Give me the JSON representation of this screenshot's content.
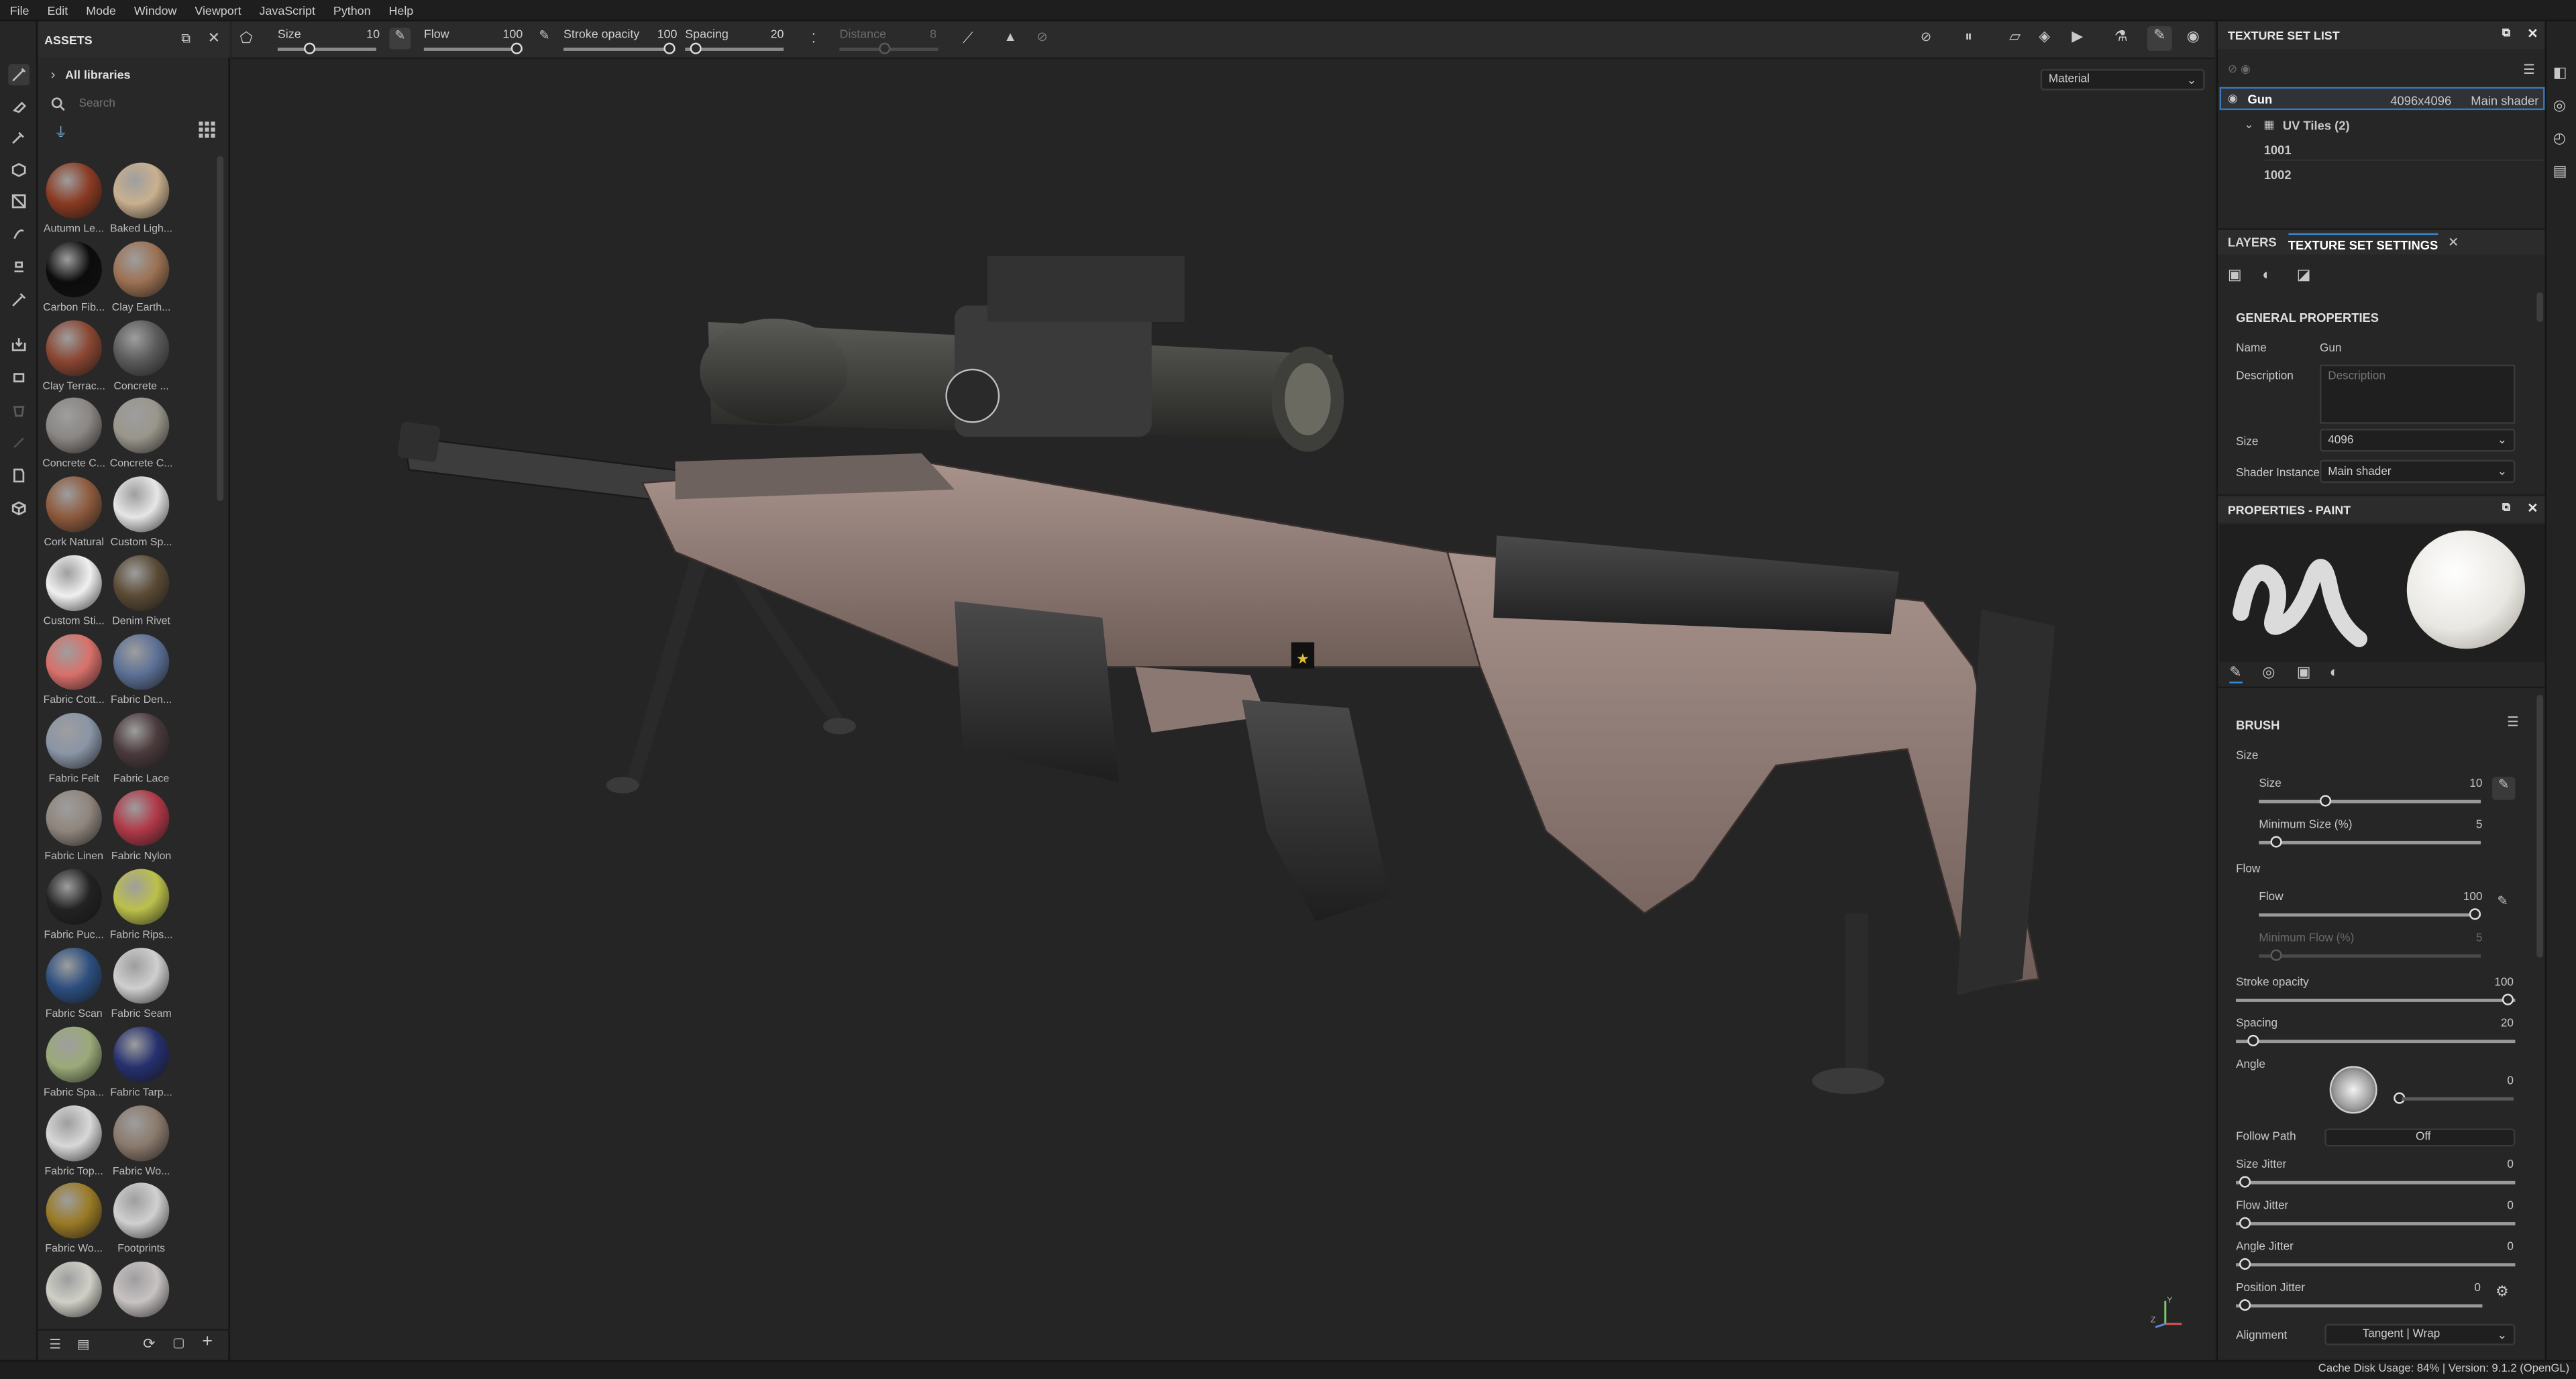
{
  "menu": [
    "File",
    "Edit",
    "Mode",
    "Window",
    "Viewport",
    "JavaScript",
    "Python",
    "Help"
  ],
  "assets": {
    "title": "ASSETS",
    "library": "All libraries",
    "search_placeholder": "Search",
    "items": [
      {
        "label": "Autumn Le...",
        "color": "#8a3a22"
      },
      {
        "label": "Baked Ligh...",
        "color": "#c9b08f"
      },
      {
        "label": "Carbon Fib...",
        "color": "#0c0c0c"
      },
      {
        "label": "Clay Earth...",
        "color": "#9c7153"
      },
      {
        "label": "Clay Terrac...",
        "color": "#8a4531"
      },
      {
        "label": "Concrete ...",
        "color": "#5a5a5a"
      },
      {
        "label": "Concrete C...",
        "color": "#8a8683"
      },
      {
        "label": "Concrete C...",
        "color": "#9a968c"
      },
      {
        "label": "Cork Natural",
        "color": "#8e5a3d"
      },
      {
        "label": "Custom Sp...",
        "color": "#e6e6e6"
      },
      {
        "label": "Custom Sti...",
        "color": "#f0f0f0"
      },
      {
        "label": "Denim Rivet",
        "color": "#5a4a35"
      },
      {
        "label": "Fabric Cott...",
        "color": "#d9706a"
      },
      {
        "label": "Fabric Den...",
        "color": "#5c7096"
      },
      {
        "label": "Fabric Felt",
        "color": "#8a95a6"
      },
      {
        "label": "Fabric Lace",
        "color": "#4a3a3c"
      },
      {
        "label": "Fabric Linen",
        "color": "#8f857c"
      },
      {
        "label": "Fabric Nylon",
        "color": "#b03848"
      },
      {
        "label": "Fabric Puc...",
        "color": "#222222"
      },
      {
        "label": "Fabric Rips...",
        "color": "#bcc04a"
      },
      {
        "label": "Fabric Scan",
        "color": "#2c4e7e"
      },
      {
        "label": "Fabric Seam",
        "color": "#cfcfcf"
      },
      {
        "label": "Fabric Spa...",
        "color": "#9aaa78"
      },
      {
        "label": "Fabric Tarp...",
        "color": "#26306e"
      },
      {
        "label": "Fabric Top...",
        "color": "#d8d8d8"
      },
      {
        "label": "Fabric Wo...",
        "color": "#8a7a6c"
      },
      {
        "label": "Fabric Wo...",
        "color": "#9a7a25"
      },
      {
        "label": "Footprints",
        "color": "#d0d0d0"
      },
      {
        "label": "",
        "color": "#cfcfc6"
      },
      {
        "label": "",
        "color": "#c8c2c2"
      }
    ]
  },
  "toolbar": {
    "size_label": "Size",
    "size_value": "10",
    "flow_label": "Flow",
    "flow_value": "100",
    "stroke_label": "Stroke opacity",
    "stroke_value": "100",
    "spacing_label": "Spacing",
    "spacing_value": "20",
    "distance_label": "Distance",
    "distance_value": "8"
  },
  "viewport": {
    "mode_select": "Material"
  },
  "texture_set_list": {
    "title": "TEXTURE SET LIST",
    "set_name": "Gun",
    "set_size": "4096x4096",
    "set_shader": "Main shader",
    "uv_tiles": "UV Tiles (2)",
    "tiles": [
      "1001",
      "1002"
    ]
  },
  "tabs": {
    "layers": "LAYERS",
    "settings": "TEXTURE SET SETTINGS"
  },
  "general": {
    "title": "GENERAL PROPERTIES",
    "name_label": "Name",
    "name_value": "Gun",
    "desc_label": "Description",
    "desc_placeholder": "Description",
    "size_label": "Size",
    "size_value": "4096",
    "shader_label": "Shader Instance",
    "shader_value": "Main shader"
  },
  "paint": {
    "title": "PROPERTIES - PAINT",
    "brush": "BRUSH",
    "size_group": "Size",
    "size_label": "Size",
    "size_value": "10",
    "min_size_label": "Minimum Size (%)",
    "min_size_value": "5",
    "flow_group": "Flow",
    "flow_label": "Flow",
    "flow_value": "100",
    "min_flow_label": "Minimum Flow (%)",
    "min_flow_value": "5",
    "stroke_label": "Stroke opacity",
    "stroke_value": "100",
    "spacing_label": "Spacing",
    "spacing_value": "20",
    "angle_label": "Angle",
    "angle_value": "0",
    "follow_label": "Follow Path",
    "follow_value": "Off",
    "size_jitter_label": "Size Jitter",
    "size_jitter_value": "0",
    "flow_jitter_label": "Flow Jitter",
    "flow_jitter_value": "0",
    "angle_jitter_label": "Angle Jitter",
    "angle_jitter_value": "0",
    "pos_jitter_label": "Position Jitter",
    "pos_jitter_value": "0",
    "alignment_label": "Alignment",
    "alignment_value": "Tangent | Wrap"
  },
  "status": {
    "text": "Cache Disk Usage:   84% | Version: 9.1.2 (OpenGL)"
  }
}
